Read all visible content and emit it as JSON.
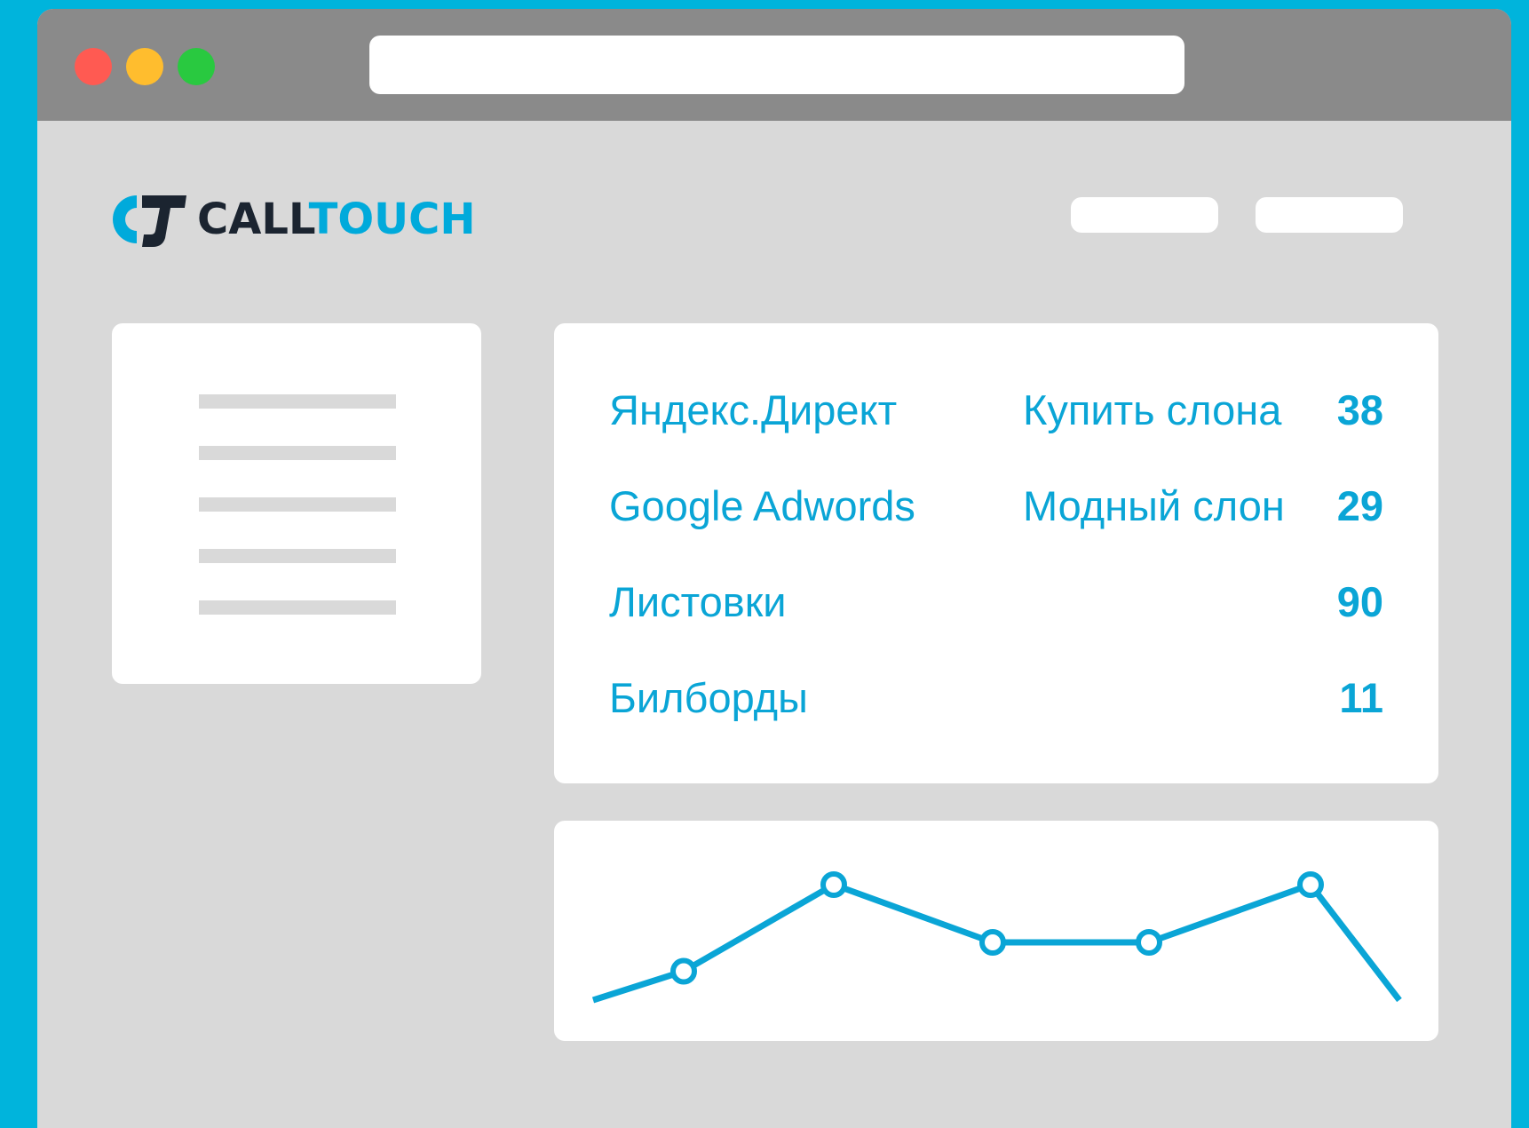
{
  "brand": {
    "name_dark": "CALL",
    "name_blue": "TOUCH",
    "dark_color": "#1b2430",
    "accent_color": "#00aadb"
  },
  "window": {
    "traffic_lights": [
      "close-dot",
      "minimize-dot",
      "zoom-dot"
    ]
  },
  "sources_table": {
    "rows": [
      {
        "source": "Яндекс.Директ",
        "campaign": "Купить слона",
        "count": "38"
      },
      {
        "source": "Google Adwords",
        "campaign": "Модный слон",
        "count": "29"
      },
      {
        "source": "Листовки",
        "campaign": "",
        "count": "90"
      },
      {
        "source": "Билборды",
        "campaign": "",
        "count": "11"
      }
    ]
  },
  "chart_data": {
    "type": "line",
    "x": [
      0,
      1,
      2,
      3,
      4,
      5,
      6
    ],
    "values": [
      1,
      2,
      5,
      3,
      3,
      5,
      1
    ],
    "markers": [
      false,
      true,
      true,
      true,
      true,
      true,
      false
    ],
    "ylim": [
      0,
      6
    ],
    "line_color": "#0aa5d6",
    "grid": false
  }
}
